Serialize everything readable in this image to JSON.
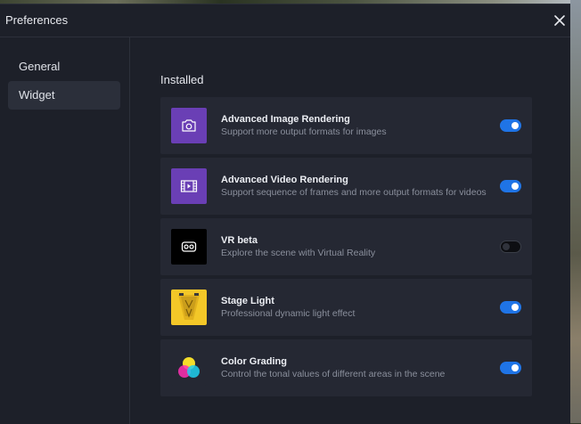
{
  "window": {
    "title": "Preferences"
  },
  "sidebar": {
    "items": [
      {
        "label": "General",
        "active": false
      },
      {
        "label": "Widget",
        "active": true
      }
    ]
  },
  "main": {
    "section_title": "Installed",
    "plugins": [
      {
        "name": "Advanced Image Rendering",
        "description": "Support more output formats for images",
        "icon": "camera-icon",
        "icon_bg": "#6a3fb5",
        "enabled": true
      },
      {
        "name": "Advanced Video Rendering",
        "description": "Support sequence of frames and more output formats for videos",
        "icon": "film-icon",
        "icon_bg": "#6a3fb5",
        "enabled": true
      },
      {
        "name": "VR beta",
        "description": "Explore the scene with Virtual Reality",
        "icon": "vr-headset-icon",
        "icon_bg": "#000000",
        "enabled": false
      },
      {
        "name": "Stage Light",
        "description": "Professional dynamic light effect",
        "icon": "stage-light-icon",
        "icon_bg": "#f3c728",
        "enabled": true
      },
      {
        "name": "Color Grading",
        "description": "Control the tonal values of different areas in the scene",
        "icon": "color-circles-icon",
        "icon_bg": "#252833",
        "enabled": true
      }
    ]
  },
  "colors": {
    "accent": "#1f74e6",
    "background": "#1d2029",
    "card": "#252833"
  }
}
